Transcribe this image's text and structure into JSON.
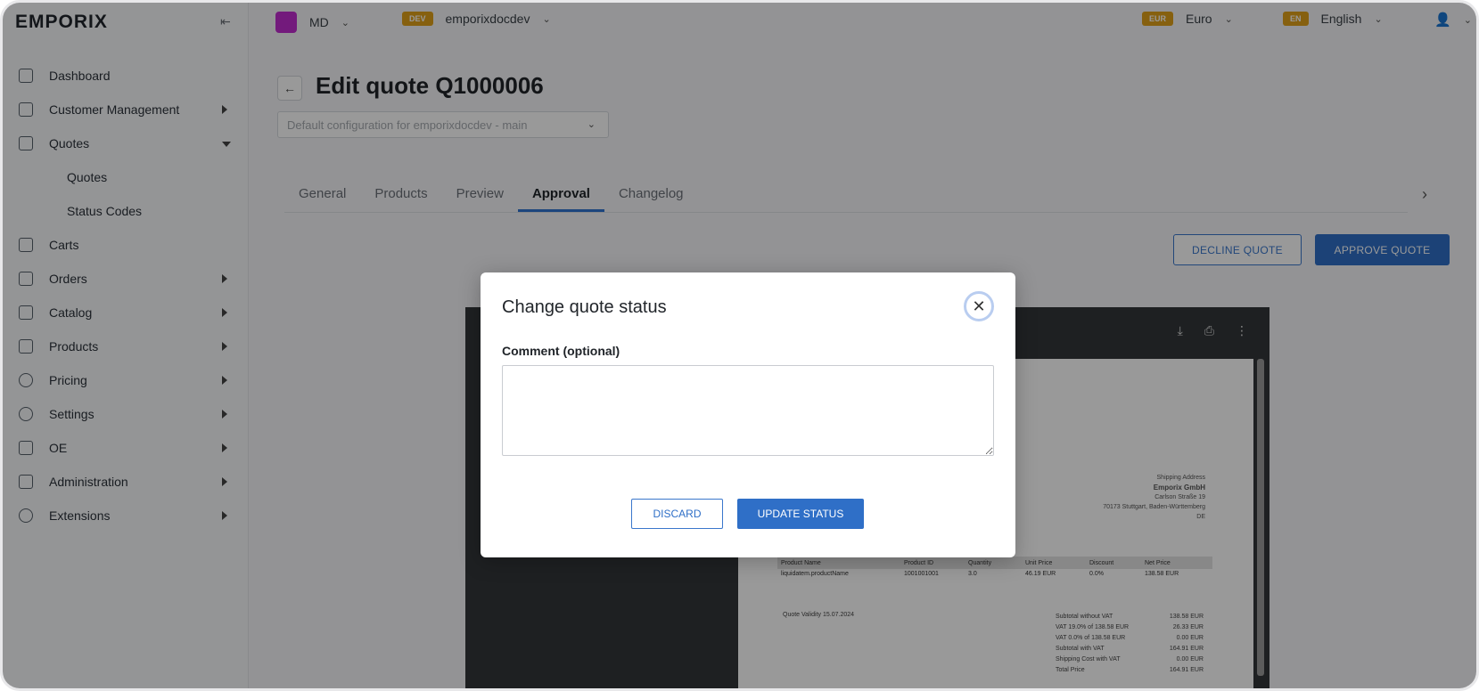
{
  "app": {
    "logo": "EMPORIX",
    "collapse_icon": "⇤"
  },
  "sidebar": {
    "items": [
      {
        "label": "Dashboard",
        "icon": "home-icon"
      },
      {
        "label": "Customer Management",
        "icon": "customers-icon"
      },
      {
        "label": "Quotes",
        "icon": "quotes-icon"
      },
      {
        "label": "Quotes",
        "icon": ""
      },
      {
        "label": "Status Codes",
        "icon": ""
      },
      {
        "label": "Carts",
        "icon": "cart-icon"
      },
      {
        "label": "Orders",
        "icon": "orders-icon"
      },
      {
        "label": "Catalog",
        "icon": "catalog-icon"
      },
      {
        "label": "Products",
        "icon": "products-icon"
      },
      {
        "label": "Pricing",
        "icon": "pricing-icon"
      },
      {
        "label": "Settings",
        "icon": "settings-icon"
      },
      {
        "label": "OE",
        "icon": "oe-icon"
      },
      {
        "label": "Administration",
        "icon": "admin-icon"
      },
      {
        "label": "Extensions",
        "icon": "extensions-icon"
      }
    ]
  },
  "topbar": {
    "site_initial": "",
    "site_code": "MD",
    "tenant_badge": "DEV",
    "tenant": "emporixdocdev",
    "currency_badge": "EUR",
    "currency": "Euro",
    "language_badge": "EN",
    "language": "English"
  },
  "main": {
    "back_arrow": "←",
    "title": "Edit quote Q1000006",
    "config_select": "Default configuration for emporixdocdev - main",
    "tabs": [
      {
        "label": "General"
      },
      {
        "label": "Products"
      },
      {
        "label": "Preview"
      },
      {
        "label": "Approval"
      },
      {
        "label": "Changelog"
      }
    ],
    "tab_arrow": "›",
    "decline_label": "DECLINE QUOTE",
    "approve_label": "APPROVE QUOTE"
  },
  "pdf": {
    "ship_title": "Shipping Address",
    "ship_company": "Emporix GmbH",
    "ship_street": "Carlson Straße 19",
    "ship_city": "70173 Stuttgart, Baden-Württemberg",
    "ship_country": "DE",
    "table_headers": [
      "Product Name",
      "Product ID",
      "Quantity",
      "Unit Price",
      "Discount",
      "Net Price"
    ],
    "table_row": [
      "liquidatem.productName",
      "1001001001",
      "3.0",
      "46.19 EUR",
      "0.0%",
      "138.58 EUR"
    ],
    "validity": "Quote Validity 15.07.2024",
    "totals": [
      {
        "label": "Subtotal without VAT",
        "value": "138.58 EUR"
      },
      {
        "label": "VAT 19.0% of 138.58 EUR",
        "value": "26.33 EUR"
      },
      {
        "label": "VAT 0.0% of 138.58 EUR",
        "value": "0.00 EUR"
      },
      {
        "label": "Subtotal with VAT",
        "value": "164.91 EUR"
      },
      {
        "label": "Shipping Cost with VAT",
        "value": "0.00 EUR"
      },
      {
        "label": "Total Price",
        "value": "164.91 EUR"
      }
    ]
  },
  "modal": {
    "title": "Change quote status",
    "close_glyph": "✕",
    "comment_label": "Comment (optional)",
    "comment_value": "",
    "comment_placeholder": "",
    "discard_label": "DISCARD",
    "update_label": "UPDATE STATUS"
  }
}
